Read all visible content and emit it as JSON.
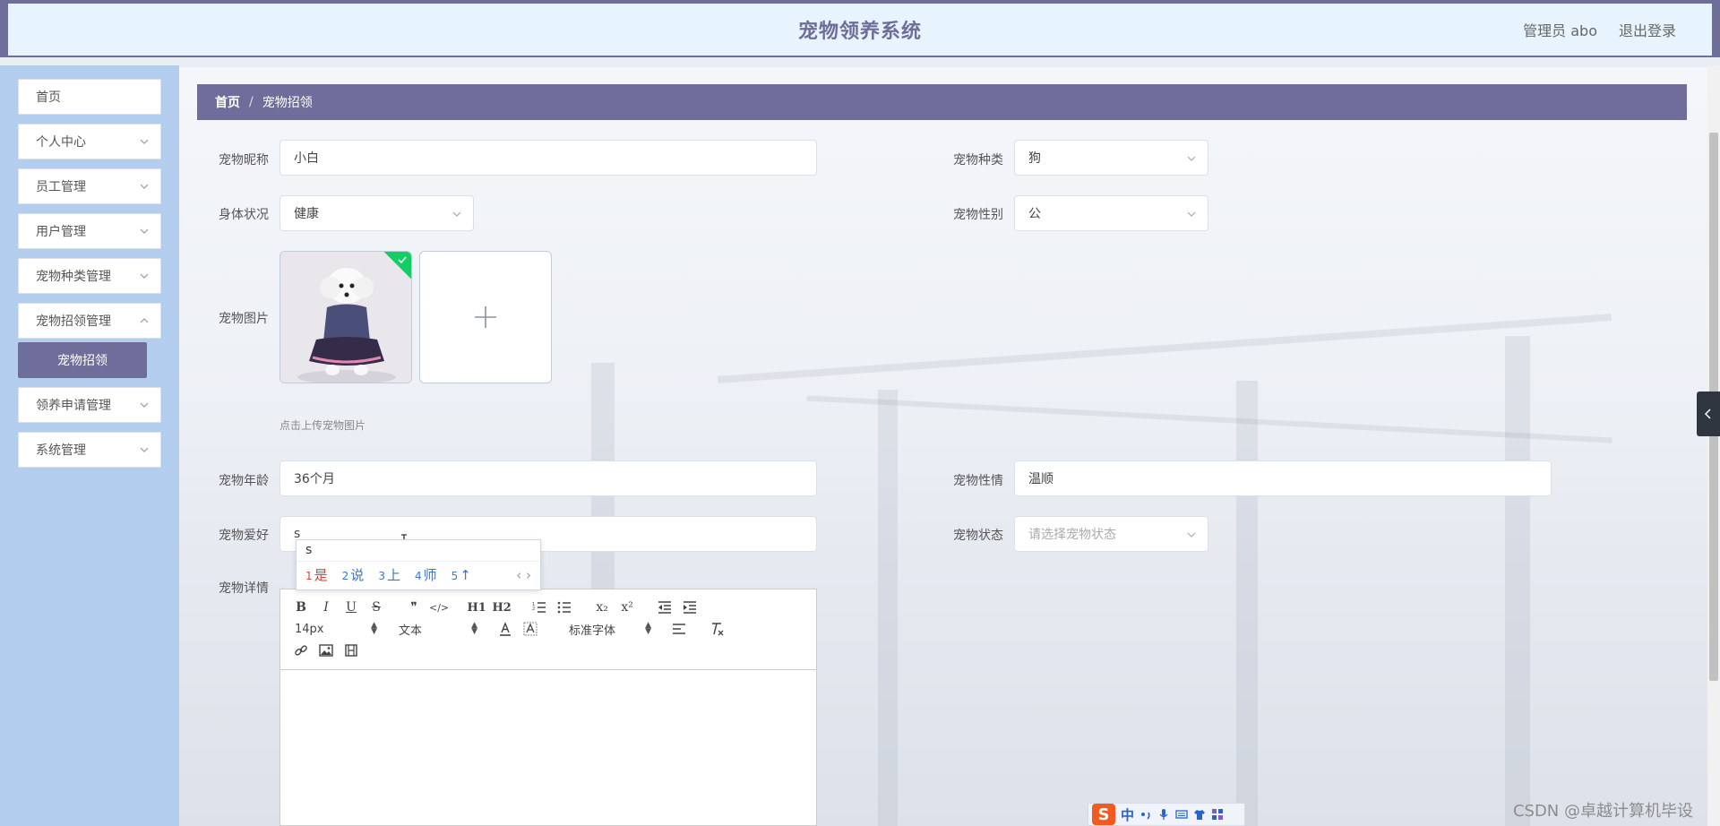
{
  "header": {
    "title": "宠物领养系统",
    "user": "管理员 abo",
    "logout": "退出登录"
  },
  "sidebar": {
    "items": [
      {
        "label": "首页",
        "has_children": false
      },
      {
        "label": "个人中心",
        "has_children": true
      },
      {
        "label": "员工管理",
        "has_children": true
      },
      {
        "label": "用户管理",
        "has_children": true
      },
      {
        "label": "宠物种类管理",
        "has_children": true
      },
      {
        "label": "宠物招领管理",
        "has_children": true
      },
      {
        "label": "领养申请管理",
        "has_children": true
      },
      {
        "label": "系统管理",
        "has_children": true
      }
    ],
    "active_sub": "宠物招领"
  },
  "breadcrumb": {
    "home": "首页",
    "separator": "/",
    "current": "宠物招领"
  },
  "form": {
    "nickname": {
      "label": "宠物昵称",
      "value": "小白"
    },
    "species": {
      "label": "宠物种类",
      "value": "狗"
    },
    "health": {
      "label": "身体状况",
      "value": "健康"
    },
    "gender": {
      "label": "宠物性别",
      "value": "公"
    },
    "image": {
      "label": "宠物图片",
      "hint": "点击上传宠物图片"
    },
    "age": {
      "label": "宠物年龄",
      "value": "36个月"
    },
    "temper": {
      "label": "宠物性情",
      "value": "温顺"
    },
    "hobby": {
      "label": "宠物爱好",
      "value": "s"
    },
    "status": {
      "label": "宠物状态",
      "placeholder": "请选择宠物状态"
    },
    "detail": {
      "label": "宠物详情"
    }
  },
  "editor": {
    "font_size": "14px",
    "block_format": "文本",
    "font_family": "标准字体",
    "buttons_row1": [
      "B",
      "I",
      "U",
      "S",
      "❞",
      "</>",
      "H1",
      "H2",
      "ol",
      "ul",
      "x₂",
      "x²",
      "outdent",
      "indent"
    ]
  },
  "ime": {
    "composition": "s",
    "candidates": [
      {
        "num": "1",
        "text": "是"
      },
      {
        "num": "2",
        "text": "说"
      },
      {
        "num": "3",
        "text": "上"
      },
      {
        "num": "4",
        "text": "师"
      },
      {
        "num": "5",
        "text": "↑"
      }
    ],
    "pager": "‹ ›"
  },
  "imebar": {
    "logo": "S",
    "mode": "中"
  },
  "watermark": "CSDN @卓越计算机毕设",
  "colors": {
    "primary": "#6f6d99",
    "header_bg": "#e8f4fd",
    "sidebar_bg": "#b2cded",
    "success": "#13ce66"
  }
}
